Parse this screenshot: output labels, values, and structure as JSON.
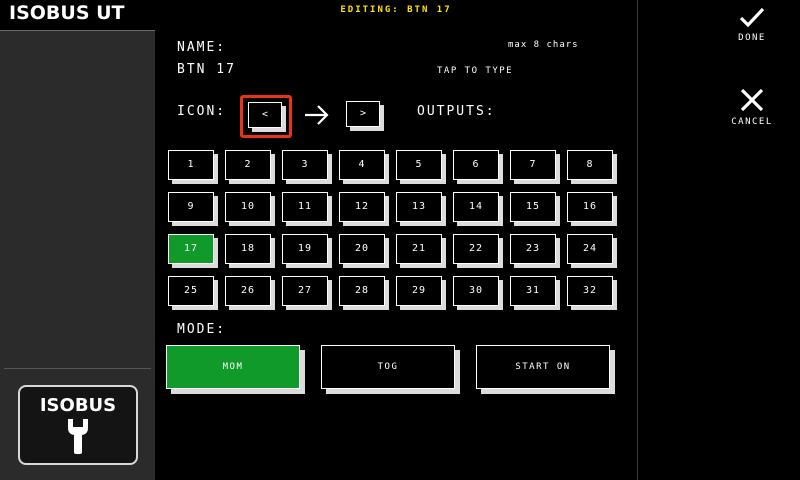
{
  "app": {
    "title": "ISOBUS UT"
  },
  "sidebar": {
    "isobus_label": "ISOBUS"
  },
  "actions": {
    "done_label": "DONE",
    "cancel_label": "CANCEL"
  },
  "editor": {
    "editing_title": "EDITING: BTN 17",
    "name_label": "NAME:",
    "name_value": "BTN 17",
    "max_chars": "max 8 chars",
    "tap_hint": "TAP TO TYPE",
    "icon_label": "ICON:",
    "icon_glyph": "<",
    "output_glyph": ">",
    "outputs_label": "OUTPUTS:",
    "outputs": [
      "1",
      "2",
      "3",
      "4",
      "5",
      "6",
      "7",
      "8",
      "9",
      "10",
      "11",
      "12",
      "13",
      "14",
      "15",
      "16",
      "17",
      "18",
      "19",
      "20",
      "21",
      "22",
      "23",
      "24",
      "25",
      "26",
      "27",
      "28",
      "29",
      "30",
      "31",
      "32"
    ],
    "selected_output": "17",
    "mode_label": "MODE:",
    "modes": [
      "MOM",
      "TOG",
      "START ON"
    ],
    "selected_mode": "MOM"
  },
  "colors": {
    "accent_green": "#0f9a2a",
    "title_yellow": "#ffe400",
    "selection_red": "#e8321a"
  }
}
